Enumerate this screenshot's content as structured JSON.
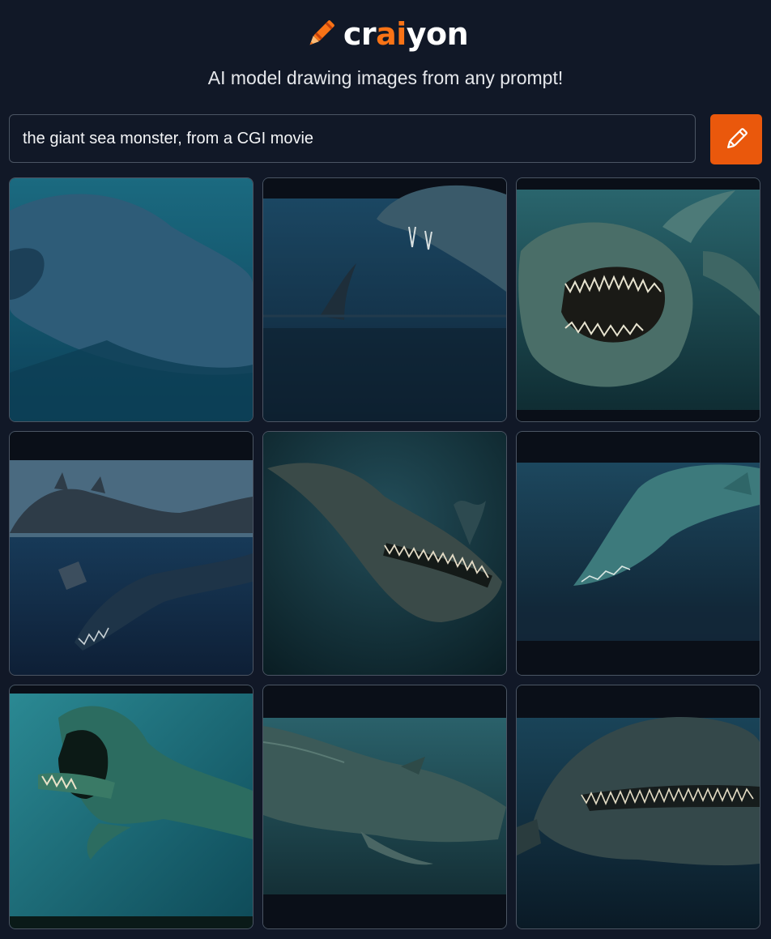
{
  "brand": {
    "name_pre": "cr",
    "name_accent": "ai",
    "name_post": "yon",
    "accent_color": "#f97316"
  },
  "tagline": "AI model drawing images from any prompt!",
  "search": {
    "value": "the giant sea monster, from a CGI movie",
    "button_icon": "pencil-icon",
    "button_color": "#ea580c"
  },
  "results": {
    "count": 9,
    "items": [
      {
        "icon": "sea-monster-image"
      },
      {
        "icon": "sea-monster-image"
      },
      {
        "icon": "sea-monster-image"
      },
      {
        "icon": "sea-monster-image"
      },
      {
        "icon": "sea-monster-image"
      },
      {
        "icon": "sea-monster-image"
      },
      {
        "icon": "sea-monster-image"
      },
      {
        "icon": "sea-monster-image"
      },
      {
        "icon": "sea-monster-image"
      }
    ]
  }
}
